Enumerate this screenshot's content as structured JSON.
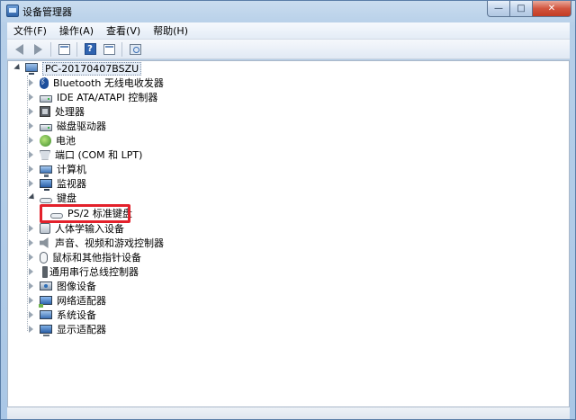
{
  "window": {
    "title": "设备管理器",
    "buttons": {
      "minimize": "—",
      "maximize": "□",
      "close": "✕"
    }
  },
  "menu": [
    {
      "label": "文件(F)"
    },
    {
      "label": "操作(A)"
    },
    {
      "label": "查看(V)"
    },
    {
      "label": "帮助(H)"
    }
  ],
  "toolbar": {
    "buttons": [
      "back-icon",
      "forward-icon",
      "properties-icon",
      "help-icon",
      "update-icon",
      "scan-icon"
    ]
  },
  "tree": {
    "root": {
      "label": "PC-20170407BSZU",
      "icon": "computer-icon"
    },
    "categories": [
      {
        "label": "Bluetooth 无线电收发器",
        "icon": "bluetooth-icon",
        "expanded": false
      },
      {
        "label": "IDE ATA/ATAPI 控制器",
        "icon": "drive-controller-icon",
        "expanded": false
      },
      {
        "label": "处理器",
        "icon": "processor-icon",
        "expanded": false
      },
      {
        "label": "磁盘驱动器",
        "icon": "disk-drive-icon",
        "expanded": false
      },
      {
        "label": "电池",
        "icon": "battery-icon",
        "expanded": false
      },
      {
        "label": "端口 (COM 和 LPT)",
        "icon": "port-icon",
        "expanded": false
      },
      {
        "label": "计算机",
        "icon": "computer-icon",
        "expanded": false
      },
      {
        "label": "监视器",
        "icon": "monitor-icon",
        "expanded": false
      },
      {
        "label": "键盘",
        "icon": "keyboard-icon",
        "expanded": true,
        "children": [
          {
            "label": "PS/2 标准键盘",
            "icon": "keyboard-icon"
          }
        ]
      },
      {
        "label": "人体学输入设备",
        "icon": "hid-icon",
        "expanded": false
      },
      {
        "label": "声音、视频和游戏控制器",
        "icon": "sound-icon",
        "expanded": false
      },
      {
        "label": "鼠标和其他指针设备",
        "icon": "mouse-icon",
        "expanded": false
      },
      {
        "label": "通用串行总线控制器",
        "icon": "usb-icon",
        "expanded": false
      },
      {
        "label": "图像设备",
        "icon": "camera-icon",
        "expanded": false
      },
      {
        "label": "网络适配器",
        "icon": "network-icon",
        "expanded": false
      },
      {
        "label": "系统设备",
        "icon": "system-icon",
        "expanded": false
      },
      {
        "label": "显示适配器",
        "icon": "display-icon",
        "expanded": false
      }
    ]
  },
  "colors": {
    "highlight": "#e3212b",
    "window_frame": "#aac7e6"
  }
}
